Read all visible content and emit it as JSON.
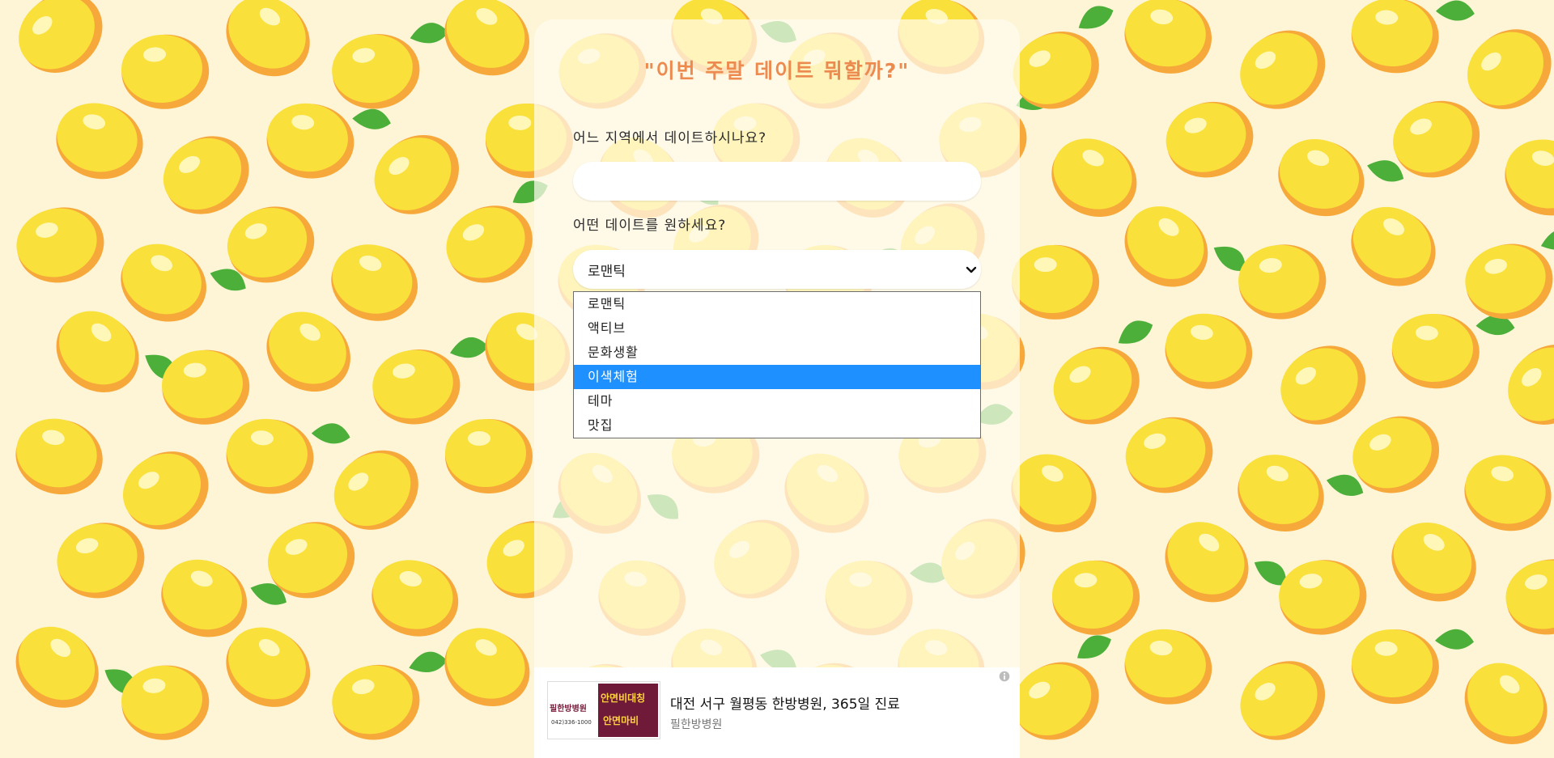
{
  "page": {
    "title": "\"이번 주말 데이트 뭐할까?\""
  },
  "form": {
    "region_label": "어느 지역에서 데이트하시나요?",
    "region_value": "",
    "region_placeholder": "",
    "type_label": "어떤 데이트를 원하세요?",
    "type_selected": "로맨틱",
    "options": [
      {
        "label": "로맨틱",
        "highlighted": false
      },
      {
        "label": "액티브",
        "highlighted": false
      },
      {
        "label": "문화생활",
        "highlighted": false
      },
      {
        "label": "이색체험",
        "highlighted": true
      },
      {
        "label": "테마",
        "highlighted": false
      },
      {
        "label": "맛집",
        "highlighted": false
      }
    ]
  },
  "ad": {
    "title": "대전 서구 월평동 한방병원, 365일 진료",
    "advertiser": "필한방병원",
    "thumb_brand": "필한방병원",
    "thumb_tag1": "안면비대칭",
    "thumb_tag2": "안면마비",
    "thumb_phone": "042)336-1000",
    "info_icon": "info-icon"
  },
  "colors": {
    "background": "#fdf5d6",
    "title": "#ec8a4f",
    "highlight": "#1e90ff",
    "lemon": "#f9e03a",
    "leaf": "#4caf3a"
  }
}
